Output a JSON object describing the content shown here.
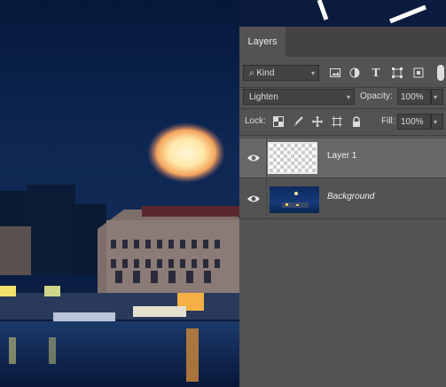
{
  "panel": {
    "tab_label": "Layers",
    "filter": {
      "label": "Kind",
      "icons": [
        "image-filter-icon",
        "adjustment-filter-icon",
        "type-filter-icon",
        "shape-filter-icon",
        "smart-object-filter-icon"
      ]
    },
    "blend_mode": "Lighten",
    "opacity_label": "Opacity:",
    "opacity_value": "100%",
    "lock_label": "Lock:",
    "fill_label": "Fill:",
    "fill_value": "100%"
  },
  "layers": [
    {
      "name": "Layer 1",
      "selected": true,
      "visible": true
    },
    {
      "name": "Background",
      "selected": false,
      "visible": true
    }
  ],
  "colors": {
    "panel_bg": "#535353",
    "selected_row": "#686868",
    "canvas_bg": "#0d2752"
  }
}
